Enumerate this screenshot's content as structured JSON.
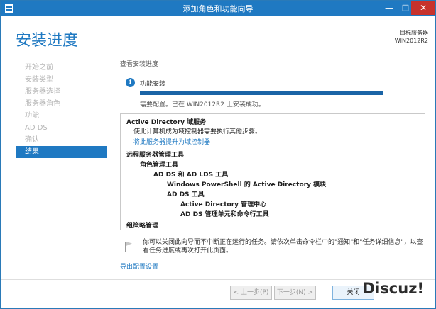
{
  "window": {
    "title": "添加角色和功能向导",
    "controls": {
      "minimize": "—",
      "maximize": "□",
      "close": "✕"
    }
  },
  "header": {
    "title": "安装进度",
    "server_label": "目标服务器",
    "server_name": "WIN2012R2"
  },
  "nav": {
    "items": [
      {
        "label": "开始之前",
        "active": false
      },
      {
        "label": "安装类型",
        "active": false
      },
      {
        "label": "服务器选择",
        "active": false
      },
      {
        "label": "服务器角色",
        "active": false
      },
      {
        "label": "功能",
        "active": false
      },
      {
        "label": "AD DS",
        "active": false
      },
      {
        "label": "确认",
        "active": false
      },
      {
        "label": "结果",
        "active": true
      }
    ]
  },
  "main": {
    "section_label": "查看安装进度",
    "feature_label": "功能安装",
    "progress": 1.0,
    "status_text": "需要配置。已在 WIN2012R2 上安装成功。",
    "results": [
      "Active Directory 域服务",
      "使此计算机成为域控制器需要执行其他步骤。",
      "将此服务器提升为域控制器",
      "远程服务器管理工具",
      "角色管理工具",
      "AD DS 和 AD LDS 工具",
      "Windows PowerShell 的 Active Directory 模块",
      "AD DS 工具",
      "Active Directory 管理中心",
      "AD DS 管理单元和命令行工具",
      "组策略管理"
    ],
    "note": "你可以关闭此向导而不中断正在运行的任务。请依次单击命令栏中的\"通知\"和\"任务详细信息\"，以查看任务进度或再次打开此页面。",
    "export_link": "导出配置设置"
  },
  "footer": {
    "prev": "< 上一步(P)",
    "next": "下一步(N) >",
    "close": "关闭"
  },
  "watermark": "Discuz!",
  "colors": {
    "accent": "#1f79c2",
    "close_button": "#c7322c",
    "progress_fill": "#1a64a6"
  }
}
